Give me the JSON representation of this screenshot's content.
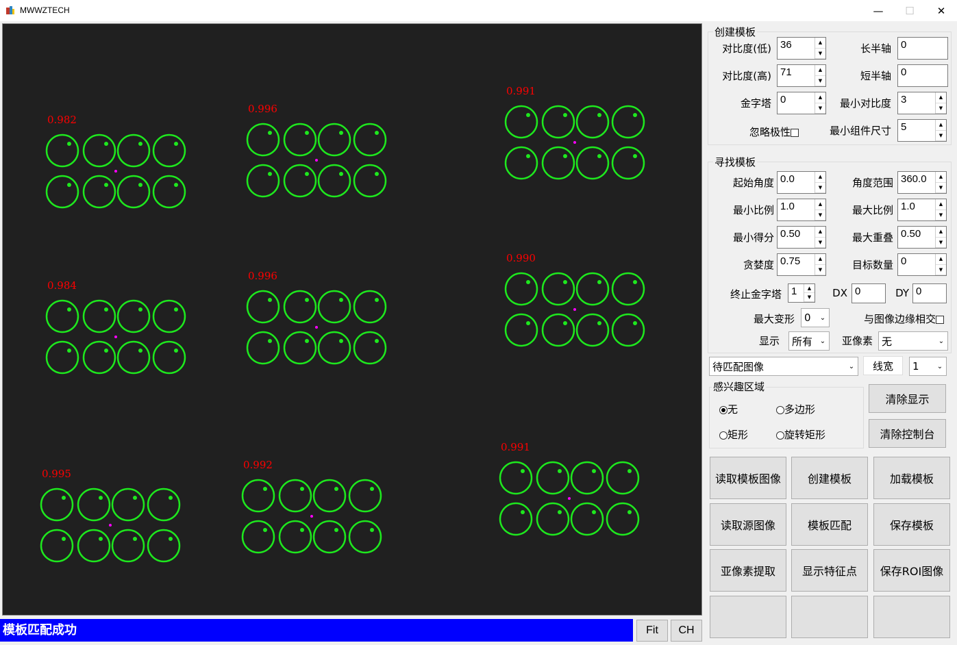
{
  "window": {
    "title": "MWWZTECH",
    "minimize": "—",
    "maximize": "☐",
    "close": "✕"
  },
  "viewer": {
    "matches": [
      {
        "score": "0.982",
        "score_color": "#ff0000",
        "ring_color": "#1ee81e"
      },
      {
        "score": "0.996"
      },
      {
        "score": "0.991"
      },
      {
        "score": "0.984"
      },
      {
        "score": "0.996"
      },
      {
        "score": "0.990"
      },
      {
        "score": "0.995"
      },
      {
        "score": "0.992"
      },
      {
        "score": "0.991"
      }
    ]
  },
  "status": {
    "message": "模板匹配成功",
    "fit_label": "Fit",
    "ch_label": "CH"
  },
  "create_template": {
    "title": "创建模板",
    "contrast_low_label": "对比度(低)",
    "contrast_low": "36",
    "contrast_high_label": "对比度(高)",
    "contrast_high": "71",
    "pyramid_label": "金字塔",
    "pyramid": "0",
    "ignore_polarity_label": "忽略极性",
    "long_axis_label": "长半轴",
    "long_axis": "0",
    "short_axis_label": "短半轴",
    "short_axis": "0",
    "min_contrast_label": "最小对比度",
    "min_contrast": "3",
    "min_component_label": "最小组件尺寸",
    "min_component": "5"
  },
  "find_template": {
    "title": "寻找模板",
    "start_angle_label": "起始角度",
    "start_angle": "0.0",
    "angle_range_label": "角度范围",
    "angle_range": "360.0",
    "min_scale_label": "最小比例",
    "min_scale": "1.0",
    "max_scale_label": "最大比例",
    "max_scale": "1.0",
    "min_score_label": "最小得分",
    "min_score": "0.50",
    "max_overlap_label": "最大重叠",
    "max_overlap": "0.50",
    "greediness_label": "贪婪度",
    "greediness": "0.75",
    "num_targets_label": "目标数量",
    "num_targets": "0",
    "end_pyramid_label": "终止金字塔",
    "end_pyramid": "1",
    "dx_label": "DX",
    "dx": "0",
    "dy_label": "DY",
    "dy": "0",
    "max_deform_label": "最大变形",
    "max_deform": "0",
    "border_intersect_label": "与图像边缘相交",
    "display_label": "显示",
    "display": "所有",
    "subpixel_label": "亚像素",
    "subpixel": "无"
  },
  "image_select": {
    "value": "待匹配图像",
    "line_width_label": "线宽",
    "line_width": "1"
  },
  "roi": {
    "title": "感兴趣区域",
    "opt_none": "无",
    "opt_polygon": "多边形",
    "opt_rect": "矩形",
    "opt_rot_rect": "旋转矩形",
    "selected": "无"
  },
  "buttons": {
    "clear_display": "清除显示",
    "clear_console": "清除控制台",
    "read_template_image": "读取模板图像",
    "create_template": "创建模板",
    "load_template": "加载模板",
    "read_source_image": "读取源图像",
    "template_match": "模板匹配",
    "save_template": "保存模板",
    "subpixel_extract": "亚像素提取",
    "show_features": "显示特征点",
    "save_roi_image": "保存ROI图像"
  }
}
